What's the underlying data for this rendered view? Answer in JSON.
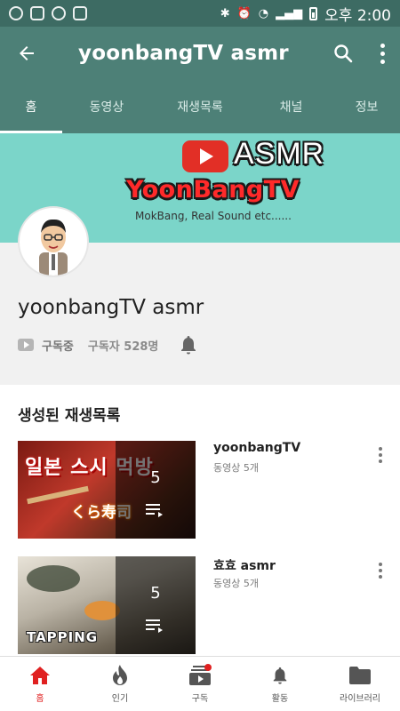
{
  "status_bar": {
    "time": "오후 2:00"
  },
  "app_bar": {
    "title": "yoonbangTV asmr"
  },
  "tabs": [
    {
      "label": "홈"
    },
    {
      "label": "동영상"
    },
    {
      "label": "재생목록"
    },
    {
      "label": "채널"
    },
    {
      "label": "정보"
    }
  ],
  "banner": {
    "logo_text": "ASMR",
    "brand": "YoonBangTV",
    "subtitle": "MokBang, Real Sound etc......"
  },
  "channel": {
    "name": "yoonbangTV asmr",
    "subscribed_label": "구독중",
    "subscriber_count": "구독자 528명"
  },
  "section": {
    "title": "생성된 재생목록",
    "playlists": [
      {
        "title": "yoonbangTV",
        "meta": "동영상 5개",
        "count": "5",
        "thumb_text": "일본 스시 먹방",
        "thumb_sub": "くら寿司"
      },
      {
        "title": "효효 asmr",
        "meta": "동영상 5개",
        "count": "5",
        "thumb_text": "TAPPING"
      }
    ]
  },
  "bottom_nav": [
    {
      "label": "홈"
    },
    {
      "label": "인기"
    },
    {
      "label": "구독"
    },
    {
      "label": "활동"
    },
    {
      "label": "라이브러리"
    }
  ],
  "colors": {
    "app_bar": "#4d8077",
    "status_bar": "#3d6b63",
    "banner": "#7bd5c9",
    "accent_red": "#e02020"
  }
}
